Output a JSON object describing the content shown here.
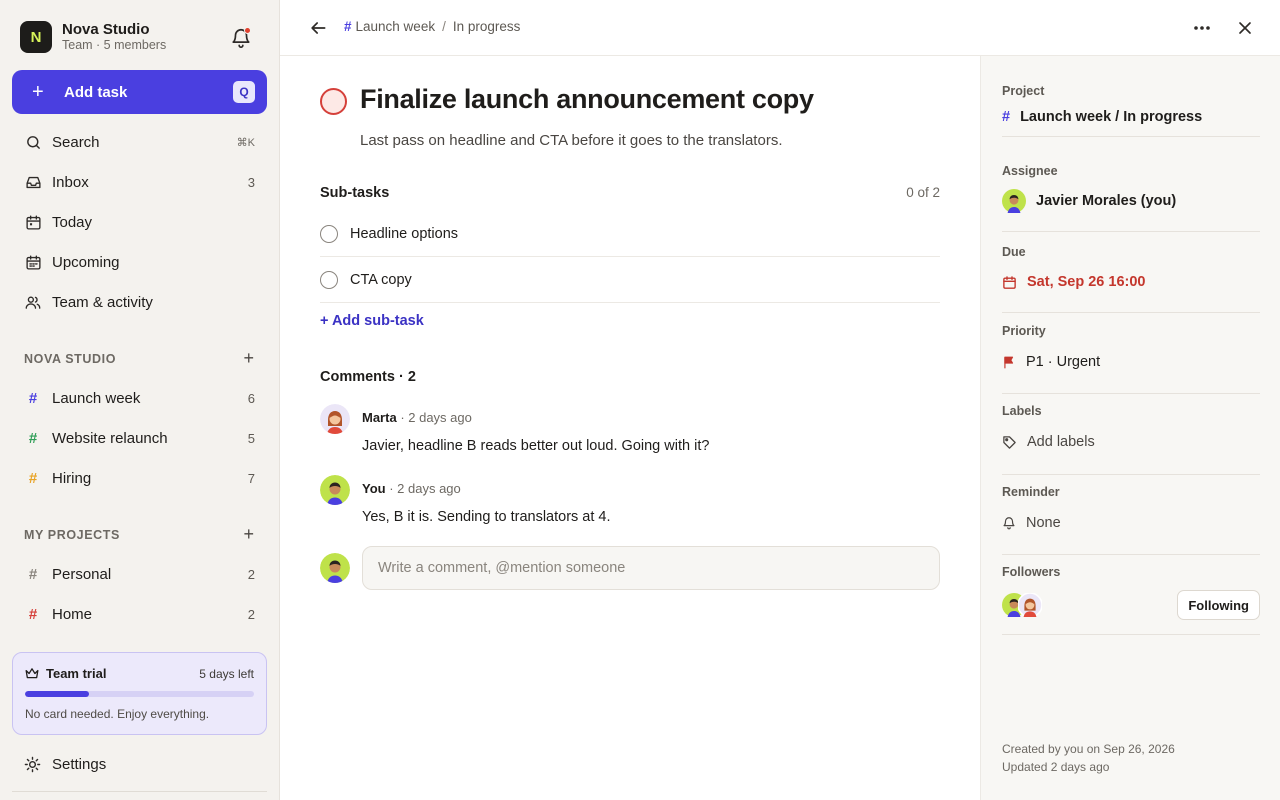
{
  "workspace": {
    "initial": "N",
    "name": "Nova Studio",
    "subtitle": "Team · 5 members"
  },
  "add_task": {
    "label": "Add task",
    "shortcut": "Q"
  },
  "nav": [
    {
      "label": "Search",
      "shortcut": "⌘K",
      "icon": "search-icon"
    },
    {
      "label": "Inbox",
      "count": "3",
      "icon": "inbox-icon"
    },
    {
      "label": "Today",
      "icon": "calendar-icon"
    },
    {
      "label": "Upcoming",
      "icon": "calendar-grid-icon"
    },
    {
      "label": "Team & activity",
      "icon": "people-icon"
    }
  ],
  "team_section": {
    "title": "NOVA STUDIO",
    "projects": [
      {
        "label": "Launch week",
        "count": "6",
        "color": "#4a3fe0"
      },
      {
        "label": "Website relaunch",
        "count": "5",
        "color": "#2f9e57"
      },
      {
        "label": "Hiring",
        "count": "7",
        "color": "#e8a325"
      }
    ]
  },
  "my_section": {
    "title": "MY PROJECTS",
    "projects": [
      {
        "label": "Personal",
        "count": "2",
        "color": "#8a857e"
      },
      {
        "label": "Home",
        "count": "2",
        "color": "#d5403a"
      }
    ]
  },
  "trial": {
    "title": "Team trial",
    "days_left": "5 days left",
    "progress": 0.28,
    "note": "No card needed. Enjoy everything."
  },
  "settings": {
    "label": "Settings"
  },
  "breadcrumb": {
    "project": "Launch week",
    "status": "In progress"
  },
  "task": {
    "title": "Finalize launch announcement copy",
    "description": "Last pass on headline and CTA before it goes to the translators.",
    "subtasks_label": "Sub-tasks",
    "subtasks_count": "0 of 2",
    "subtasks": [
      "Headline options",
      "CTA copy"
    ],
    "add_subtask": "+ Add sub-task",
    "comments_label": "Comments · 2",
    "comments": [
      {
        "author": "Marta",
        "time": "· 2 days ago",
        "text": "Javier, headline B reads better out loud. Going with it?"
      },
      {
        "author": "You",
        "time": "· 2 days ago",
        "text": "Yes, B it is. Sending to translators at 4."
      }
    ],
    "comment_placeholder": "Write a comment, @mention someone"
  },
  "panel": {
    "project_label": "Project",
    "project_value": "Launch week / In progress",
    "assignee_label": "Assignee",
    "assignee_value": "Javier Morales (you)",
    "due_label": "Due",
    "due_value": "Sat, Sep 26 16:00",
    "priority_label": "Priority",
    "priority_value": "P1 · Urgent",
    "labels_label": "Labels",
    "labels_value": "Add labels",
    "reminder_label": "Reminder",
    "reminder_value": "None",
    "followers_label": "Followers",
    "following_button": "Following",
    "created": "Created by you on Sep 26, 2026",
    "updated": "Updated 2 days ago"
  }
}
